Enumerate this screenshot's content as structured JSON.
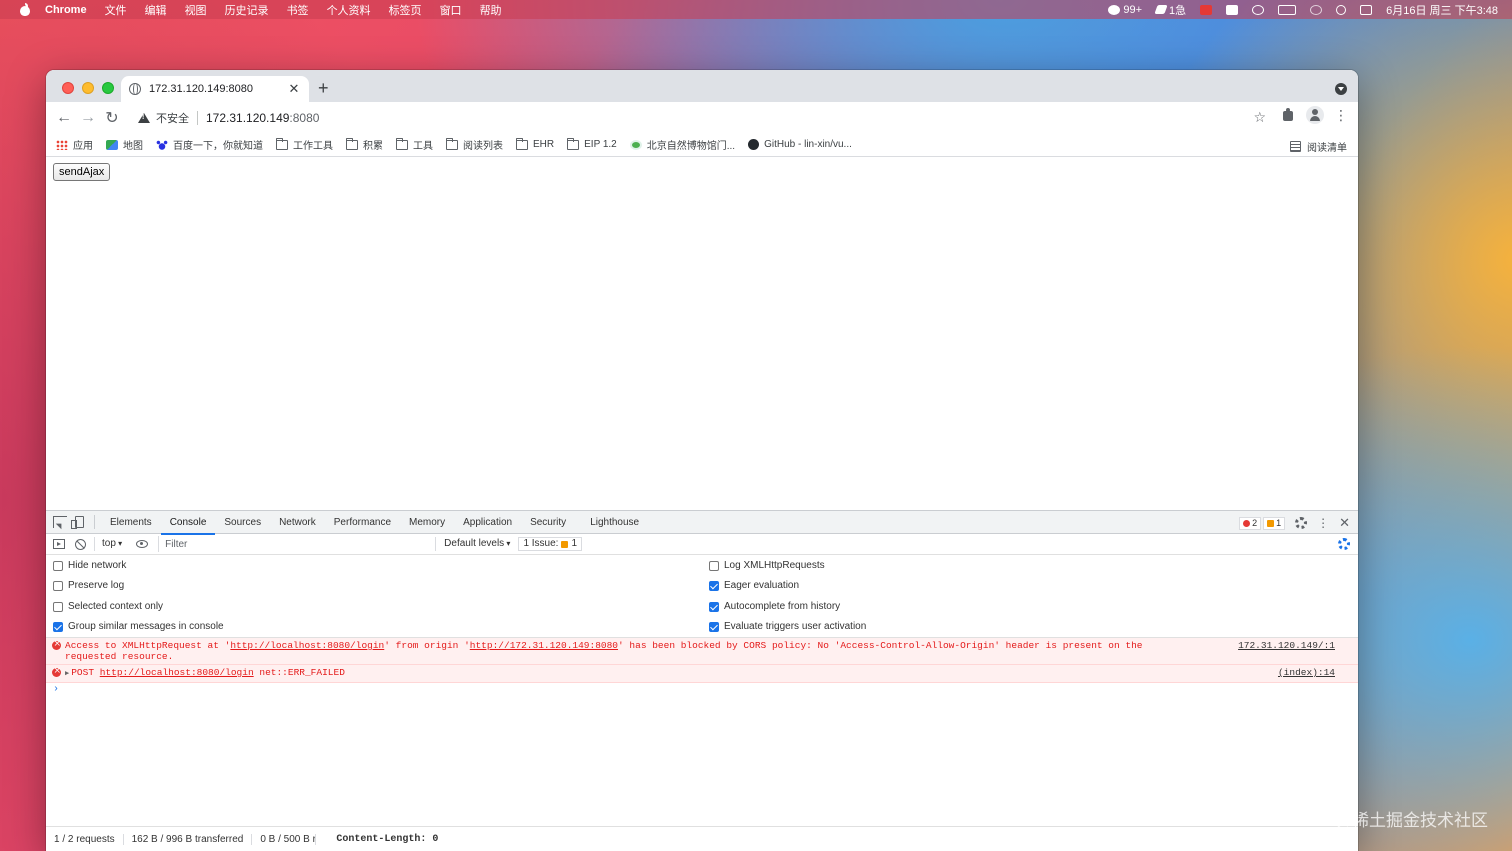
{
  "menubar": {
    "app_name": "Chrome",
    "items": [
      "文件",
      "编辑",
      "视图",
      "历史记录",
      "书签",
      "个人资料",
      "标签页",
      "窗口",
      "帮助"
    ],
    "wechat_count": "99+",
    "send_label": "1急",
    "datetime": "6月16日 周三 下午3:48"
  },
  "browser": {
    "tab_title": "172.31.120.149:8080",
    "insecure_label": "不安全",
    "url_host": "172.31.120.149",
    "url_port": ":8080",
    "bookmarks": [
      {
        "label": "应用",
        "icon": "apps-icon"
      },
      {
        "label": "地图",
        "icon": "map-icon"
      },
      {
        "label": "百度一下，你就知道",
        "icon": "baidu-icon"
      },
      {
        "label": "工作工具",
        "icon": "folder-icon"
      },
      {
        "label": "积累",
        "icon": "folder-icon"
      },
      {
        "label": "工具",
        "icon": "folder-icon"
      },
      {
        "label": "阅读列表",
        "icon": "folder-icon"
      },
      {
        "label": "EHR",
        "icon": "folder-icon"
      },
      {
        "label": "EIP 1.2",
        "icon": "folder-icon"
      },
      {
        "label": "北京自然博物馆门...",
        "icon": "museum-icon"
      },
      {
        "label": "GitHub - lin-xin/vu...",
        "icon": "github-icon"
      }
    ],
    "reading_list": "阅读清单"
  },
  "page": {
    "send_button": "sendAjax"
  },
  "devtools": {
    "tabs": [
      "Elements",
      "Console",
      "Sources",
      "Network",
      "Performance",
      "Memory",
      "Application",
      "Security",
      "Lighthouse"
    ],
    "active_tab": "Console",
    "error_count": "2",
    "warning_count": "1",
    "context": "top",
    "filter_placeholder": "Filter",
    "levels": "Default levels",
    "issues_label": "1 Issue:",
    "issues_count": "1",
    "settings_left": [
      {
        "label": "Hide network",
        "checked": false
      },
      {
        "label": "Preserve log",
        "checked": false
      },
      {
        "label": "Selected context only",
        "checked": false
      },
      {
        "label": "Group similar messages in console",
        "checked": true
      }
    ],
    "settings_right": [
      {
        "label": "Log XMLHttpRequests",
        "checked": false
      },
      {
        "label": "Eager evaluation",
        "checked": true
      },
      {
        "label": "Autocomplete from history",
        "checked": true
      },
      {
        "label": "Evaluate triggers user activation",
        "checked": true
      }
    ],
    "messages": {
      "cors": {
        "t1": "Access to XMLHttpRequest at '",
        "url1": "http://localhost:8080/login",
        "t2": "' from origin '",
        "url2": "http://172.31.120.149:8080",
        "t3": "' has been blocked by CORS policy: No 'Access-Control-Allow-Origin' header is present on the requested resource.",
        "source": "172.31.120.149/:1"
      },
      "post": {
        "method": "POST",
        "url": "http://localhost:8080/login",
        "error": "net::ERR_FAILED",
        "source": "(index):14"
      }
    },
    "status": {
      "requests": "1 / 2 requests",
      "transferred": "162 B / 996 B transferred",
      "resources": "0 B / 500 B re",
      "header_name": "Content-Length:",
      "header_value": "0"
    }
  },
  "watermark": "@稀土掘金技术社区"
}
